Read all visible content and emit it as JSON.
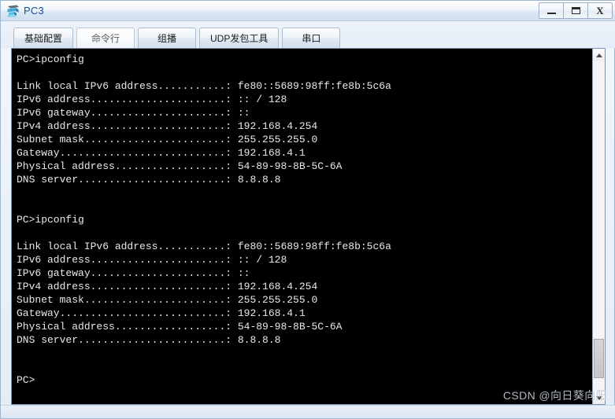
{
  "window": {
    "title": "PC3",
    "icon": "pc-device-icon",
    "controls": {
      "minimize_label": "—",
      "maximize_label": "❐",
      "close_label": "X"
    }
  },
  "tabs": [
    {
      "label": "基础配置",
      "active": false,
      "name": "tab-basic-config"
    },
    {
      "label": "命令行",
      "active": true,
      "name": "tab-command-line"
    },
    {
      "label": "组播",
      "active": false,
      "name": "tab-multicast"
    },
    {
      "label": "UDP发包工具",
      "active": false,
      "name": "tab-udp-tool"
    },
    {
      "label": "串口",
      "active": false,
      "name": "tab-serial-port"
    }
  ],
  "terminal": {
    "lines": [
      "PC>ipconfig",
      "",
      "Link local IPv6 address...........: fe80::5689:98ff:fe8b:5c6a",
      "IPv6 address......................: :: / 128",
      "IPv6 gateway......................: ::",
      "IPv4 address......................: 192.168.4.254",
      "Subnet mask.......................: 255.255.255.0",
      "Gateway...........................: 192.168.4.1",
      "Physical address..................: 54-89-98-8B-5C-6A",
      "DNS server........................: 8.8.8.8",
      "",
      "",
      "PC>ipconfig",
      "",
      "Link local IPv6 address...........: fe80::5689:98ff:fe8b:5c6a",
      "IPv6 address......................: :: / 128",
      "IPv6 gateway......................: ::",
      "IPv4 address......................: 192.168.4.254",
      "Subnet mask.......................: 255.255.255.0",
      "Gateway...........................: 192.168.4.1",
      "Physical address..................: 54-89-98-8B-5C-6A",
      "DNS server........................: 8.8.8.8",
      "",
      "",
      "PC>"
    ],
    "background_color": "#000000",
    "text_color": "#e8e8e8"
  },
  "scrollbar": {
    "up_arrow": "scroll-up-arrow",
    "down_arrow": "scroll-down-arrow",
    "thumb_top_percent": 84,
    "thumb_height_percent": 12
  },
  "watermark": {
    "text": "CSDN @向日葵向阳"
  },
  "colors": {
    "title_text": "#1a4f8a",
    "frame_border": "#9fb6cd",
    "tab_active_bg": "#ffffff",
    "console_bg": "#000000"
  }
}
